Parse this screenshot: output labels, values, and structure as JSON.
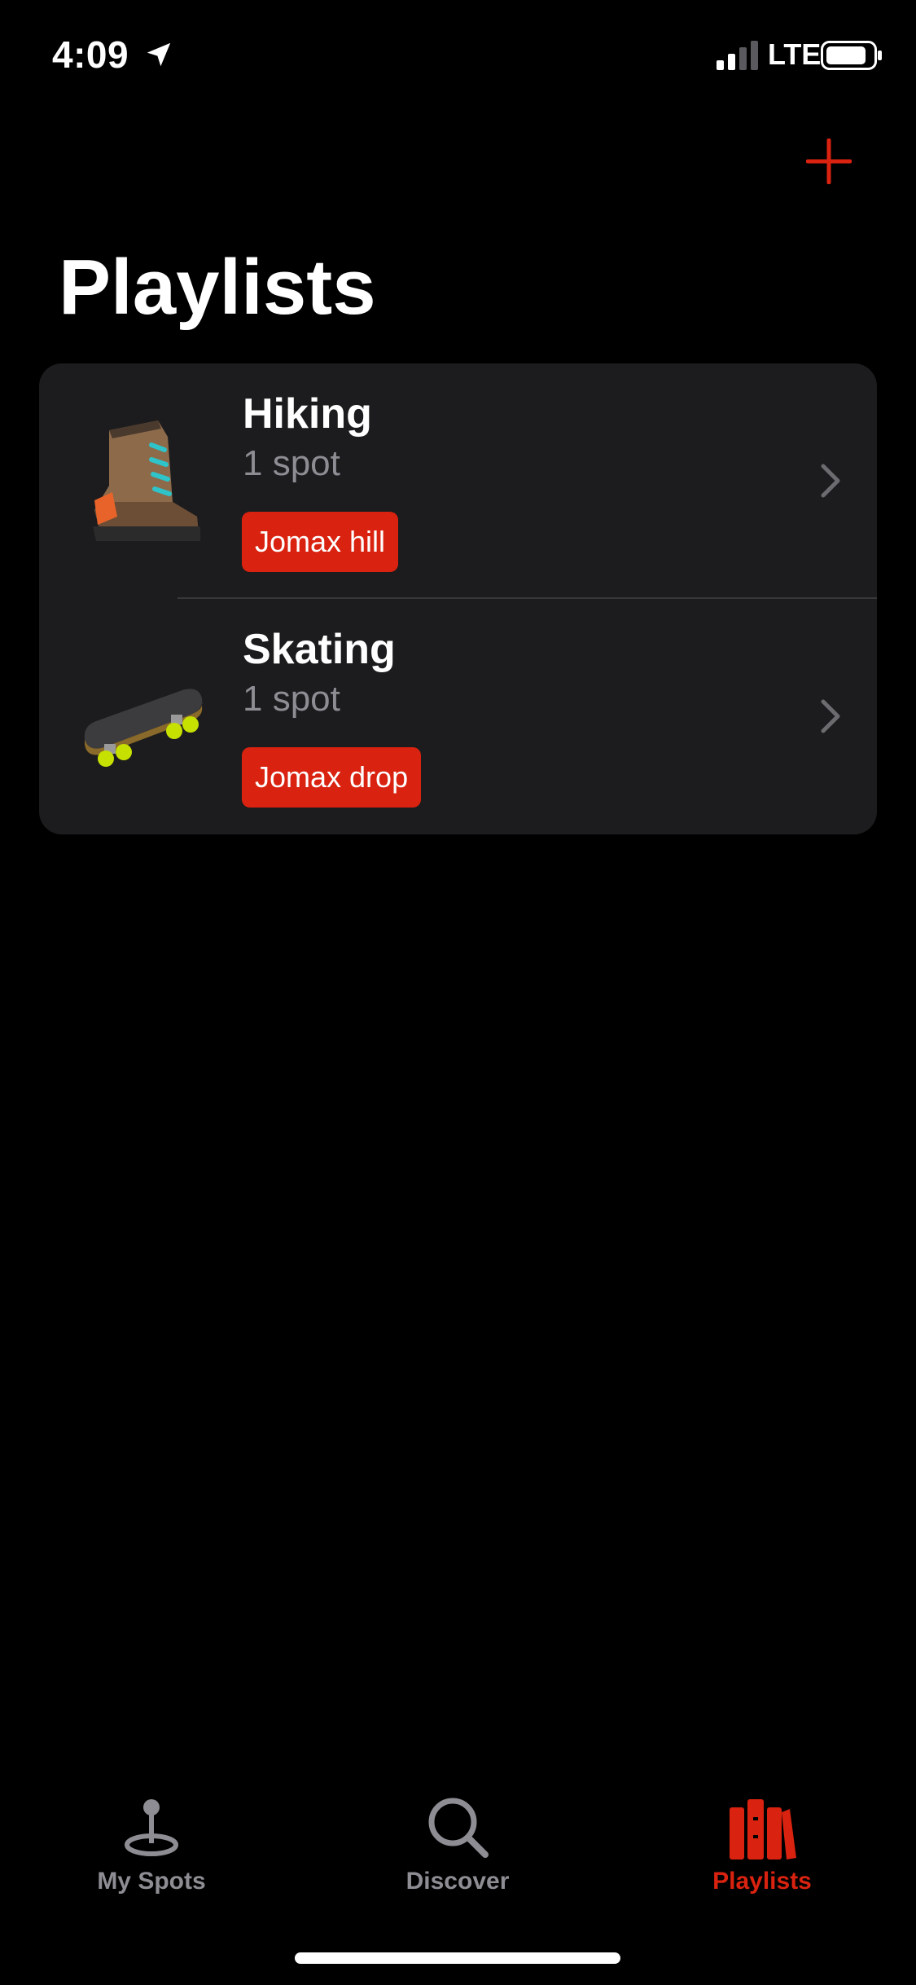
{
  "status_bar": {
    "time": "4:09",
    "network": "LTE",
    "location_icon": "location-arrow-icon",
    "signal_icon": "cellular-signal-icon",
    "battery_icon": "battery-icon"
  },
  "header": {
    "add_icon": "plus-icon",
    "title": "Playlists"
  },
  "playlists": [
    {
      "title": "Hiking",
      "count": "1 spot",
      "tag": "Jomax hill",
      "icon": "hiking-boot-icon"
    },
    {
      "title": "Skating",
      "count": "1 spot",
      "tag": "Jomax drop",
      "icon": "skateboard-icon"
    }
  ],
  "tabs": [
    {
      "label": "My Spots",
      "icon": "map-pin-icon",
      "active": false
    },
    {
      "label": "Discover",
      "icon": "search-icon",
      "active": false
    },
    {
      "label": "Playlists",
      "icon": "books-icon",
      "active": true
    }
  ],
  "colors": {
    "accent": "#d9220f",
    "background": "#000000",
    "card": "#1c1c1e",
    "secondary_text": "#8d8d93"
  }
}
